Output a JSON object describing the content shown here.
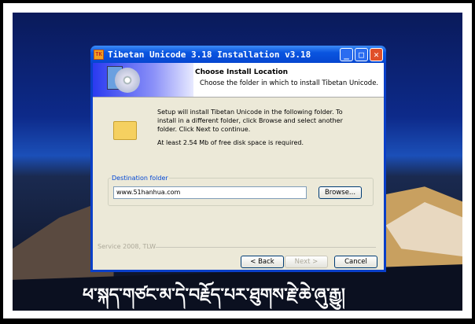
{
  "window": {
    "title": "Tibetan Unicode 3.18 Installation v3.18"
  },
  "header": {
    "title": "Choose Install Location",
    "subtitle": "Choose the folder in which to install Tibetan Unicode."
  },
  "body": {
    "description": "Setup will install Tibetan Unicode in the following folder. To install in a different folder, click Browse and select another folder. Click Next to continue.",
    "space_required": "At least 2.54 Mb of free disk space is required.",
    "destination_label": "Destination folder",
    "destination_value": "www.51hanhua.com",
    "browse_label": "Browse..."
  },
  "footer": {
    "branding": "Service 2008, TLW",
    "back_label": "< Back",
    "next_label": "Next >",
    "cancel_label": "Cancel"
  },
  "caption": "ཕ་སྐད་གཙང་མ་དེ་བརྗོད་པར་ཐུགས་རྗེ་ཆེ་ཞུ་རྒྱུ།"
}
